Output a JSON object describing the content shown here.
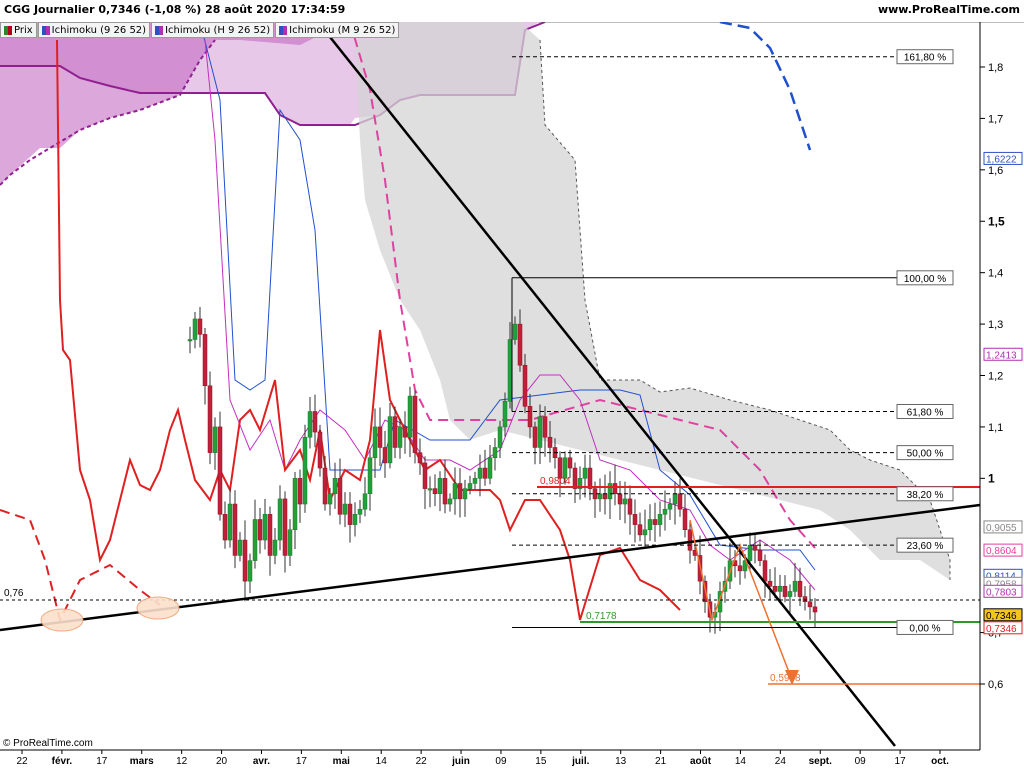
{
  "header": {
    "title": "CGG Journalier 0,7346 (-1,08 %) 28 août 2020 17:34:59",
    "site": "www.ProRealTime.com"
  },
  "legend": [
    {
      "label": "Prix",
      "color": "#2a8a2a",
      "color2": "#b00020"
    },
    {
      "label": "Ichimoku (9 26 52)",
      "color": "#3050c0",
      "color2": "#b030b0"
    },
    {
      "label": "Ichimoku (H 9 26 52)",
      "color": "#3050c0",
      "color2": "#b030b0"
    },
    {
      "label": "Ichimoku (M 9 26 52)",
      "color": "#3050c0",
      "color2": "#b030b0"
    }
  ],
  "footer": {
    "copyright": "© ProRealTime.com"
  },
  "chart_data": {
    "type": "candlestick",
    "ylim": [
      0.5,
      1.88
    ],
    "y_ticks": [
      {
        "v": 0.6,
        "label": "0,6"
      },
      {
        "v": 0.7,
        "label": "0,7"
      },
      {
        "v": 1.0,
        "label": "1",
        "bold": true
      },
      {
        "v": 1.1,
        "label": "1,1"
      },
      {
        "v": 1.2,
        "label": "1,2"
      },
      {
        "v": 1.3,
        "label": "1,3"
      },
      {
        "v": 1.4,
        "label": "1,4"
      },
      {
        "v": 1.5,
        "label": "1,5",
        "bold": true
      },
      {
        "v": 1.6,
        "label": "1,6"
      },
      {
        "v": 1.7,
        "label": "1,7"
      },
      {
        "v": 1.8,
        "label": "1,8"
      }
    ],
    "x_ticks": [
      "22",
      "févr.",
      "17",
      "mars",
      "12",
      "20",
      "avr.",
      "17",
      "mai",
      "14",
      "22",
      "juin",
      "09",
      "15",
      "juil.",
      "13",
      "21",
      "août",
      "14",
      "24",
      "sept.",
      "09",
      "17",
      "oct."
    ],
    "price_tags": [
      {
        "v": 1.6222,
        "label": "1,6222",
        "color": "#3050c0"
      },
      {
        "v": 1.2413,
        "label": "1,2413",
        "color": "#b030b0"
      },
      {
        "v": 0.9055,
        "label": "0,9055",
        "color": "#888888"
      },
      {
        "v": 0.8604,
        "label": "0,8604",
        "color": "#e040a0"
      },
      {
        "v": 0.8114,
        "label": "0,8114",
        "color": "#3050c0"
      },
      {
        "v": 0.7958,
        "label": "0,7958",
        "color": "#888888"
      },
      {
        "v": 0.7803,
        "label": "0,7803",
        "color": "#b030b0"
      },
      {
        "v": 0.7346,
        "label": "0,7346",
        "color": "#000000",
        "fill": "#f5c518"
      },
      {
        "v": 0.7346,
        "label": "0,7346",
        "color": "#e02020",
        "offset": 1
      }
    ],
    "fibonacci": [
      {
        "v": 1.82,
        "label": "161,80 %",
        "dashed": true
      },
      {
        "v": 1.39,
        "label": "100,00 %",
        "dashed": false
      },
      {
        "v": 1.13,
        "label": "61,80 %",
        "dashed": true
      },
      {
        "v": 1.05,
        "label": "50,00 %",
        "dashed": true
      },
      {
        "v": 0.97,
        "label": "38,20 %",
        "dashed": true
      },
      {
        "v": 0.87,
        "label": "23,60 %",
        "dashed": true
      },
      {
        "v": 0.71,
        "label": "0,00 %",
        "dashed": false
      }
    ],
    "annotations": [
      {
        "label": "0,76",
        "v": 0.76
      },
      {
        "label": "0,9804",
        "v": 0.9804,
        "color": "#e02020"
      },
      {
        "label": "0,7178",
        "v": 0.7178,
        "color": "#2a9a2a"
      },
      {
        "label": "0,5998",
        "v": 0.5998,
        "color": "#f07030"
      }
    ]
  }
}
